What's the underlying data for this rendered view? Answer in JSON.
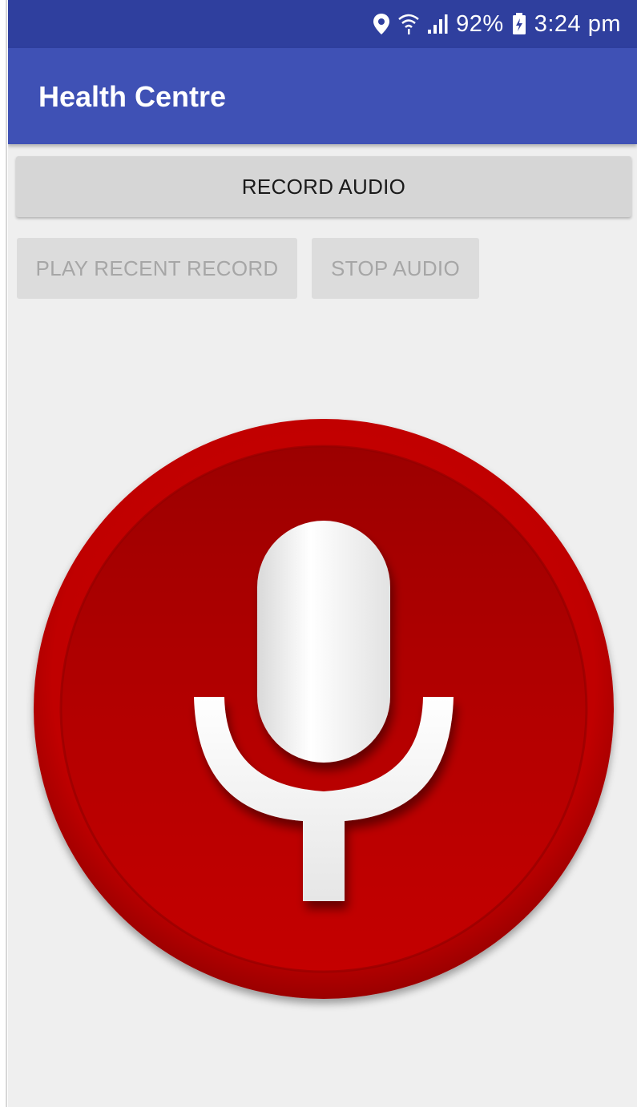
{
  "status_bar": {
    "battery_percent": "92%",
    "time": "3:24 pm",
    "icons": [
      "location-icon",
      "wifi-icon",
      "signal-icon",
      "battery-icon"
    ]
  },
  "app_bar": {
    "title": "Health Centre"
  },
  "buttons": {
    "record": "RECORD AUDIO",
    "play_recent": "PLAY RECENT RECORD",
    "stop": "STOP AUDIO"
  },
  "mic": {
    "icon": "microphone-icon",
    "color": "#c00000"
  },
  "colors": {
    "status_bar": "#2f3f9e",
    "app_bar": "#3f51b5",
    "background": "#efefef"
  }
}
